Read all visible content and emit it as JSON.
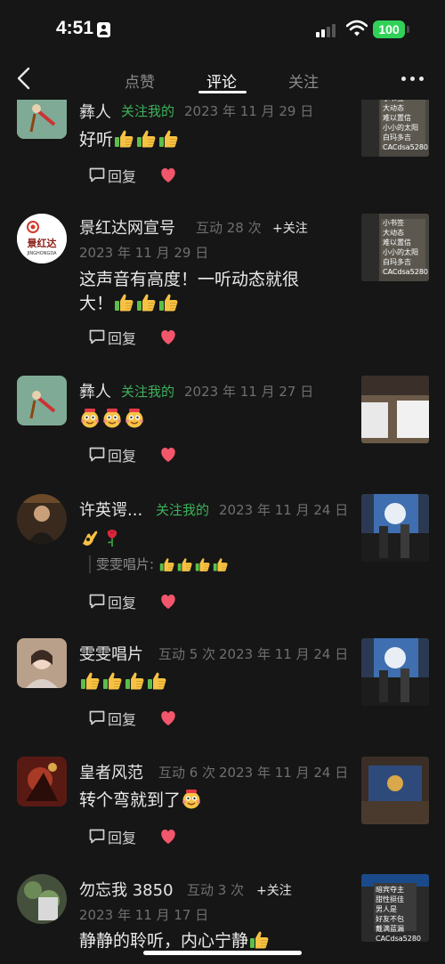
{
  "status_bar": {
    "time": "4:51",
    "battery": "100"
  },
  "nav": {
    "tabs": [
      "点赞",
      "评论",
      "关注"
    ],
    "active_tab": "评论"
  },
  "comments": [
    {
      "name": "彝人",
      "badge": "关注我的",
      "date": "2023 年 11 月 29 日",
      "text": "好听",
      "emojis": "thumbs-up x3",
      "reply": "回复"
    },
    {
      "name": "景红达网宣号",
      "interaction": "互动 28 次",
      "follow": "+关注",
      "date": "2023 年 11 月 29 日",
      "text_line1": "这声音有高度！一听动态就很",
      "text_line2": "大！",
      "emojis": "thumbs-up x3",
      "reply": "回复",
      "avatar_text": "景红达",
      "avatar_sub": "JINGHONGDA"
    },
    {
      "name": "彝人",
      "badge": "关注我的",
      "date": "2023 年 11 月 27 日",
      "emojis": "rich-face x3",
      "reply": "回复"
    },
    {
      "name": "许英谔...",
      "badge": "关注我的",
      "date": "2023 年 11 月 24 日",
      "emojis": "ok-hand, rose",
      "quote": "雯雯唱片:",
      "quote_emojis": "thumbs-up x4",
      "reply": "回复"
    },
    {
      "name": "雯雯唱片",
      "interaction": "互动 5 次",
      "date": "2023 年 11 月 24 日",
      "emojis": "thumbs-up x4",
      "reply": "回复"
    },
    {
      "name": "皇者风范",
      "interaction": "互动 6 次",
      "date": "2023 年 11 月 24 日",
      "text": "转个弯就到了",
      "emojis": "rich-face x1",
      "reply": "回复"
    },
    {
      "name": "勿忘我 3850",
      "interaction": "互动 3 次",
      "follow": "+关注",
      "date": "2023 年 11 月 17 日",
      "text": "静静的聆听，内心宁静",
      "emojis": "thumbs-up x1"
    }
  ],
  "thumbnail_text": {
    "a": [
      "小书签",
      "大动态",
      "难以置信",
      "小小的太阳",
      "白玛多吉",
      "CACdsa5280"
    ],
    "b": [
      "暗宾夺主",
      "甜性挺佳",
      "男人是",
      "好友不包",
      "戴满蓝漏",
      "CACdsa5280"
    ]
  },
  "colors": {
    "follow_green": "#3cb25a",
    "heart_red": "#f2566b",
    "battery_green": "#31d158"
  }
}
